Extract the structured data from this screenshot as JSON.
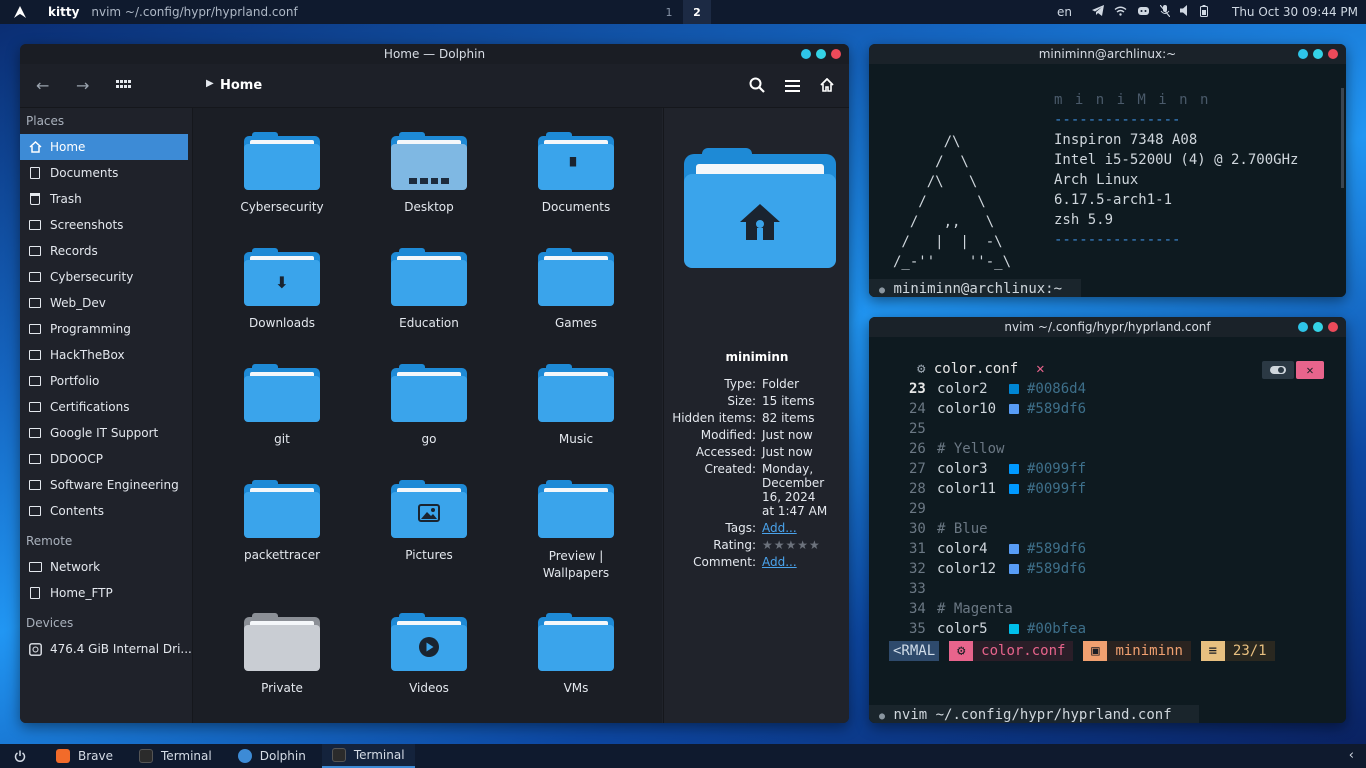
{
  "topbar": {
    "app": "kitty",
    "window_title": "nvim ~/.config/hypr/hyprland.conf",
    "workspaces": [
      "1",
      "2"
    ],
    "lang": "en",
    "clock": "Thu Oct 30  09:44 PM"
  },
  "dolphin": {
    "title": "Home — Dolphin",
    "breadcrumb": "Home",
    "places_header": "Places",
    "places": [
      "Home",
      "Documents",
      "Trash",
      "Screenshots",
      "Records",
      "Cybersecurity",
      "Web_Dev",
      "Programming",
      "HackTheBox",
      "Portfolio",
      "Certifications",
      "Google IT Support",
      "DDOOCP",
      "Software Engineering",
      "Contents"
    ],
    "remote_header": "Remote",
    "remote": [
      "Network",
      "Home_FTP"
    ],
    "devices_header": "Devices",
    "devices": [
      "476.4 GiB Internal Dri..."
    ],
    "folders": [
      "Cybersecurity",
      "Desktop",
      "Documents",
      "Downloads",
      "Education",
      "Games",
      "git",
      "go",
      "Music",
      "packettracer",
      "Pictures",
      "Preview | Wallpapers",
      "Private",
      "Videos",
      "VMs"
    ],
    "info": {
      "name": "miniminn",
      "type_label": "Type:",
      "type": "Folder",
      "size_label": "Size:",
      "size": "15 items",
      "hidden_label": "Hidden items:",
      "hidden": "82 items",
      "modified_label": "Modified:",
      "modified": "Just now",
      "accessed_label": "Accessed:",
      "accessed": "Just now",
      "created_label": "Created:",
      "created_1": "Monday,",
      "created_2": "December",
      "created_3": "16, 2024",
      "created_4": "at 1:47 AM",
      "tags_label": "Tags:",
      "tags": "Add...",
      "rating_label": "Rating:",
      "rating": "★★★★★",
      "rating_value": 0,
      "comment_label": "Comment:",
      "comment": "Add..."
    }
  },
  "term1": {
    "title": "miniminn@archlinux:~",
    "ascii": [
      "      /\\",
      "     /  \\",
      "    /\\   \\",
      "   /      \\",
      "  /   ,,   \\",
      " /   |  |  -\\",
      "/_-''    ''-_\\"
    ],
    "header": "m i n i M i n n",
    "sep": "---------------",
    "host": "Inspiron 7348 A08",
    "cpu": "Intel i5-5200U (4) @ 2.700GHz",
    "os": "Arch Linux",
    "kernel": "6.17.5-arch1-1",
    "shell": "zsh 5.9",
    "sep2": "---------------",
    "prompt": "miniminn@archlinux:~"
  },
  "term2": {
    "title": "nvim ~/.config/hypr/hyprland.conf",
    "tab": "color.conf",
    "lines": [
      {
        "n": "23",
        "t": "color2",
        "c": "#0086d4",
        "sw": "#0086d4"
      },
      {
        "n": "24",
        "t": "color10",
        "c": "#589df6",
        "sw": "#589df6"
      },
      {
        "n": "25",
        "t": "",
        "c": "",
        "sw": ""
      },
      {
        "n": "26",
        "t": "# Yellow",
        "c": "",
        "sw": ""
      },
      {
        "n": "27",
        "t": "color3",
        "c": "#0099ff",
        "sw": "#0099ff"
      },
      {
        "n": "28",
        "t": "color11",
        "c": "#0099ff",
        "sw": "#0099ff"
      },
      {
        "n": "29",
        "t": "",
        "c": "",
        "sw": ""
      },
      {
        "n": "30",
        "t": "# Blue",
        "c": "",
        "sw": ""
      },
      {
        "n": "31",
        "t": "color4",
        "c": "#589df6",
        "sw": "#589df6"
      },
      {
        "n": "32",
        "t": "color12",
        "c": "#589df6",
        "sw": "#589df6"
      },
      {
        "n": "33",
        "t": "",
        "c": "",
        "sw": ""
      },
      {
        "n": "34",
        "t": "# Magenta",
        "c": "",
        "sw": ""
      },
      {
        "n": "35",
        "t": "color5",
        "c": "#00bfea",
        "sw": "#00bfea"
      }
    ],
    "status_mode": "<RMAL",
    "status_file": "color.conf",
    "status_user": "miniminn",
    "status_pos": "23/1",
    "prompt": "nvim ~/.config/hypr/hyprland.conf"
  },
  "taskbar": {
    "items": [
      "Brave",
      "Terminal",
      "Dolphin",
      "Terminal"
    ]
  },
  "colors": {
    "accent": "#3d8bd6",
    "folder": "#3aa4eb",
    "term_text": "#cfd6dc",
    "status_pink": "#e8648c",
    "status_orange": "#f0a070",
    "status_yellow": "#e8c080"
  }
}
